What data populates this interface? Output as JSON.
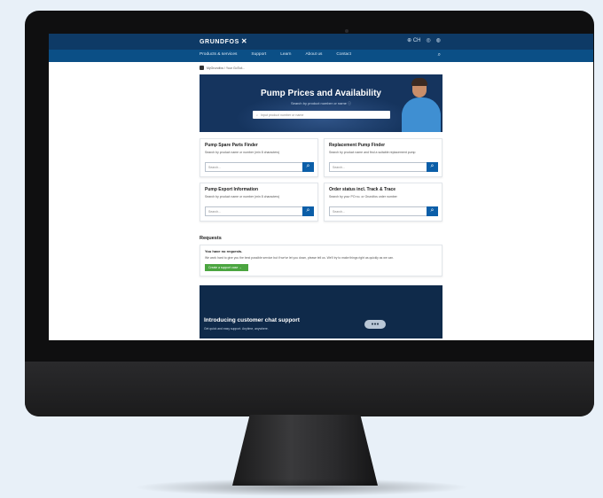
{
  "header": {
    "brand": "GRUNDFOS",
    "logo_mark": "✕",
    "country": "CH",
    "icons": [
      "globe-icon",
      "user-icon",
      "cart-icon"
    ]
  },
  "nav": {
    "items": [
      "Products & services",
      "Support",
      "Learn",
      "About us",
      "Contact"
    ],
    "search_icon": "search-icon"
  },
  "breadcrumb": {
    "text": "MyGrundfos / Your GoTo#..."
  },
  "hero": {
    "title": "Pump Prices and Availability",
    "subtitle": "Search by product number or name ⓘ",
    "input_placeholder": "Input product number or name"
  },
  "cards": [
    {
      "title": "Pump Spare Parts Finder",
      "desc": "Search by product name or number (min 8 characters)",
      "placeholder": "Search..."
    },
    {
      "title": "Replacement Pump Finder",
      "desc": "Search by product name and find a suitable replacement pump",
      "placeholder": "Search..."
    },
    {
      "title": "Pump Export Information",
      "desc": "Search by product name or number (min 8 characters)",
      "placeholder": "Search..."
    },
    {
      "title": "Order status incl. Track & Trace",
      "desc": "Search by your PO no. or Grundfos order number",
      "placeholder": "Search..."
    }
  ],
  "requests": {
    "title": "Requests",
    "heading": "You have no requests.",
    "text": "We work hard to give you the best possible service but if we've let you down, please tell us. We'll try to make things right as quickly as we can.",
    "button": "Create a support case  →"
  },
  "chat": {
    "title": "Introducing customer chat support",
    "subtitle": "Get quick and easy support. Anytime, anywhere.",
    "badge": "●●●"
  },
  "colors": {
    "header_dark": "#0e3a66",
    "nav_blue": "#0b4f86",
    "hero_bg": "#15345e",
    "action_blue": "#0b5ea8",
    "action_green": "#4ba540",
    "page_bg": "#e8f0f8"
  }
}
